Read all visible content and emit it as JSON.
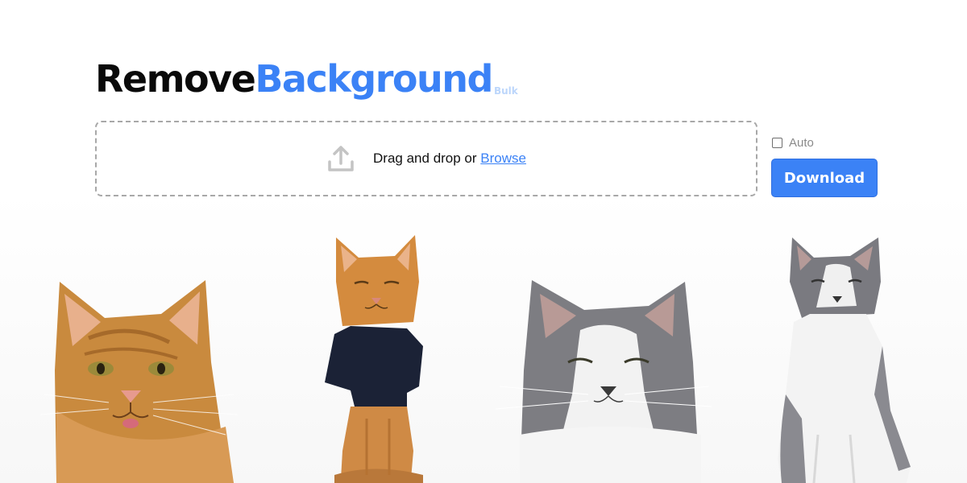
{
  "logo": {
    "part1": "Remove",
    "part2": "Background",
    "tag": "Bulk"
  },
  "dropzone": {
    "icon": "upload-icon",
    "text": "Drag and drop or ",
    "link": "Browse"
  },
  "auto_checkbox": {
    "label": "Auto",
    "checked": false
  },
  "download_button": {
    "label": "Download"
  },
  "colors": {
    "accent": "#3b82f6",
    "dashed_border": "#a8a8a8",
    "muted_text": "#8a8a8a"
  },
  "cats": [
    {
      "name": "orange-tabby-cat",
      "description": "close-up"
    },
    {
      "name": "orange-cat-in-shirt",
      "description": "wearing navy shirt"
    },
    {
      "name": "gray-white-cat",
      "description": "close-up"
    },
    {
      "name": "gray-white-cat-sitting",
      "description": "sitting"
    }
  ]
}
